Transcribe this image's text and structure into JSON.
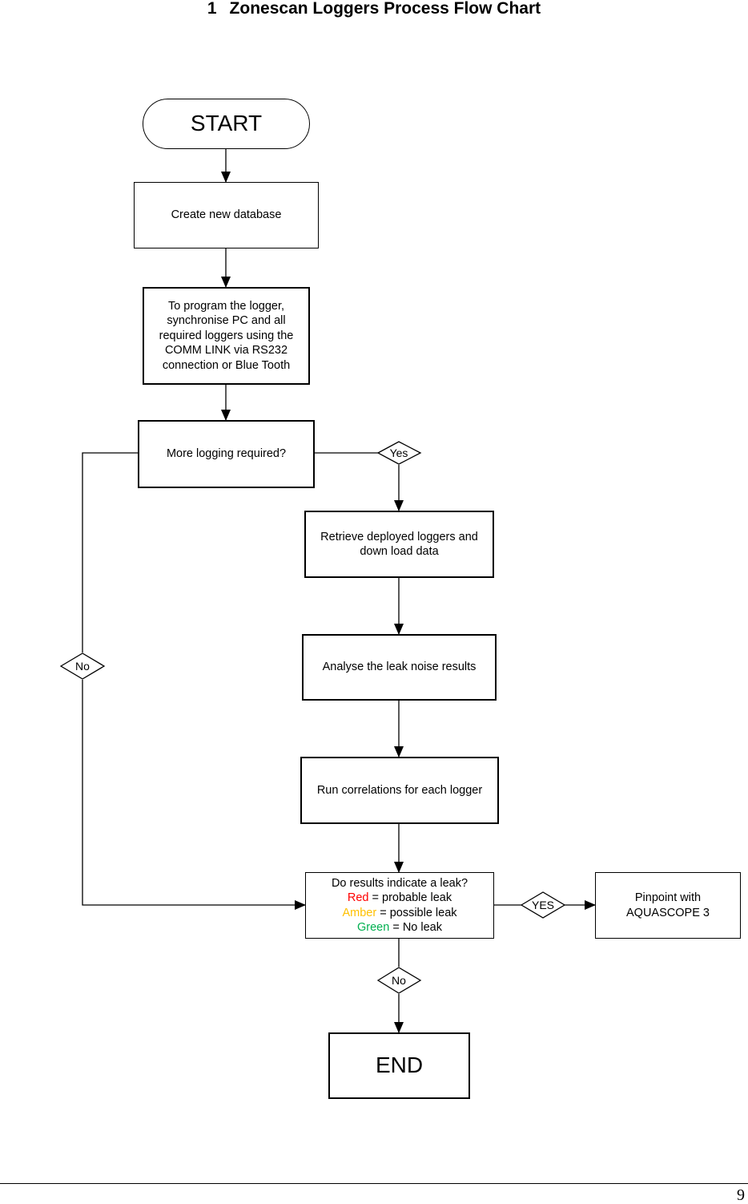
{
  "page": {
    "heading_number": "1",
    "heading_title": "Zonescan Loggers Process Flow Chart",
    "page_number": "9"
  },
  "nodes": {
    "start": "START",
    "create_db": "Create new database",
    "program_logger": [
      "To program the logger,",
      "synchronise PC and all",
      "required loggers using the",
      "COMM LINK via RS232",
      "connection or Blue Tooth"
    ],
    "more_logging": "More logging required?",
    "retrieve": [
      "Retrieve deployed loggers and",
      "down load data"
    ],
    "analyse": "Analyse the leak noise results",
    "correlations": "Run correlations for each logger",
    "leak_decision": {
      "question": "Do results indicate a leak?",
      "legend": [
        {
          "color_name": "Red",
          "meaning": "= probable leak",
          "color": "#ff0000"
        },
        {
          "color_name": "Amber",
          "meaning": "= possible leak",
          "color": "#ffc000"
        },
        {
          "color_name": "Green",
          "meaning": "= No leak",
          "color": "#00b050"
        }
      ]
    },
    "pinpoint": [
      "Pinpoint with",
      "AQUASCOPE 3"
    ],
    "end": "END"
  },
  "branch_labels": {
    "more_logging_yes": "Yes",
    "more_logging_no": "No",
    "leak_yes": "YES",
    "leak_no": "No"
  },
  "edges": [
    {
      "from": "start",
      "to": "create_db"
    },
    {
      "from": "create_db",
      "to": "program_logger"
    },
    {
      "from": "program_logger",
      "to": "more_logging"
    },
    {
      "from": "more_logging",
      "to": "retrieve",
      "label": "Yes"
    },
    {
      "from": "more_logging",
      "to": "leak_decision",
      "label": "No"
    },
    {
      "from": "retrieve",
      "to": "analyse"
    },
    {
      "from": "analyse",
      "to": "correlations"
    },
    {
      "from": "correlations",
      "to": "leak_decision"
    },
    {
      "from": "leak_decision",
      "to": "pinpoint",
      "label": "YES"
    },
    {
      "from": "leak_decision",
      "to": "end",
      "label": "No"
    }
  ]
}
